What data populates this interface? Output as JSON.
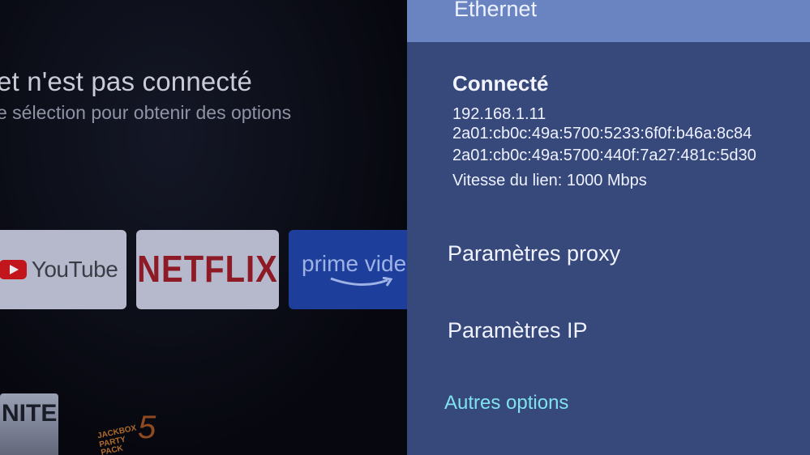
{
  "home": {
    "banner_title": "et n'est pas connecté",
    "banner_subtitle": "e sélection pour obtenir des options",
    "apps": [
      {
        "label": "YouTube",
        "icon": "youtube-play-icon",
        "accent": "#c2161c"
      },
      {
        "label": "NETFLIX",
        "accent": "#8d1a24"
      },
      {
        "label": "prime vide",
        "icon": "amazon-smile-icon",
        "accent": "#1d3f9b"
      }
    ],
    "games": [
      {
        "label": "NITE"
      },
      {
        "label": "JACKBOX PARTY PACK",
        "number": "5"
      }
    ]
  },
  "panel": {
    "title": "Ethernet",
    "status": "Connecté",
    "details": [
      "192.168.1.11",
      "2a01:cb0c:49a:5700:5233:6f0f:b46a:8c84",
      "2a01:cb0c:49a:5700:440f:7a27:481c:5d30",
      "Vitesse du lien: 1000 Mbps"
    ],
    "menu": [
      {
        "label": "Paramètres proxy"
      },
      {
        "label": "Paramètres IP"
      }
    ],
    "more_options": "Autres options",
    "colors": {
      "panel_bg": "#37487b",
      "header_bg": "#6a84c2",
      "link": "#7fe3ef"
    }
  }
}
